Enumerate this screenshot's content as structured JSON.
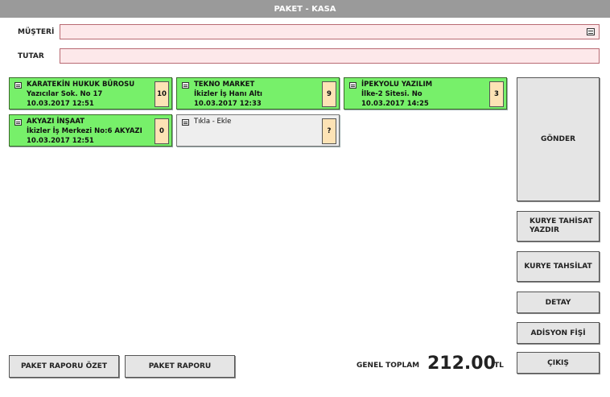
{
  "window": {
    "title": "PAKET - KASA"
  },
  "fields": {
    "musteri": {
      "label": "MÜŞTERİ",
      "value": ""
    },
    "tutar": {
      "label": "TUTAR",
      "value": ""
    }
  },
  "cards": [
    {
      "name": "KARATEKİN HUKUK BÜROSU",
      "address": "Yazıcılar Sok. No 17",
      "datetime": "10.03.2017  12:51",
      "count": "10"
    },
    {
      "name": "TEKNO MARKET",
      "address": "İkizler İş Hanı Altı",
      "datetime": "10.03.2017  12:33",
      "count": "9"
    },
    {
      "name": "İPEKYOLU YAZILIM",
      "address": "İlke-2 Sitesi. No",
      "datetime": "10.03.2017  14:25",
      "count": "3"
    },
    {
      "name": "AKYAZI İNŞAAT",
      "address": "İkizler İş Merkezi No:6 AKYAZI",
      "datetime": "10.03.2017  12:51",
      "count": "0"
    },
    {
      "name": "Tıkla - Ekle",
      "address": "",
      "datetime": "",
      "count": "?"
    }
  ],
  "side_buttons": {
    "gonder": "GÖNDER",
    "kurye_tahsilat_yazdir_1": "KURYE TAHİSAT",
    "kurye_tahsilat_yazdir_2": "YAZDIR",
    "kurye_tahsilat": "KURYE TAHSİLAT",
    "detay": "DETAY",
    "adisyon_fisi": "ADİSYON FİŞİ",
    "cikis": "ÇIKIŞ"
  },
  "bottom": {
    "paket_raporu_ozet": "PAKET RAPORU ÖZET",
    "paket_raporu": "PAKET RAPORU",
    "genel_toplam_label": "GENEL TOPLAM",
    "genel_toplam_value": "212.00",
    "currency": "TL"
  },
  "colors": {
    "card_active": "#77f06a",
    "card_empty": "#eeeeee",
    "count_badge": "#fde3b5",
    "input_bg": "#fde8ea",
    "titlebar": "#9a9a9a"
  }
}
